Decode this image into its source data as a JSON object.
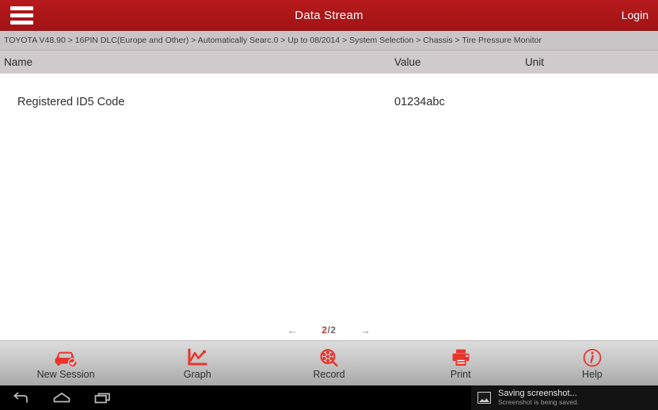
{
  "titlebar": {
    "menu_icon": "hamburger-menu-icon",
    "title": "Data Stream",
    "login_label": "Login",
    "bg_color": "#ab1618"
  },
  "breadcrumb": {
    "text": "TOYOTA V48.90 > 16PIN DLC(Europe and Other) > Automatically Searc.0 > Up to 08/2014 > System Selection > Chassis > Tire Pressure Monitor"
  },
  "table": {
    "headers": {
      "name": "Name",
      "value": "Value",
      "unit": "Unit"
    },
    "rows": [
      {
        "name": "Registered ID5 Code",
        "value": "01234abc",
        "unit": ""
      }
    ]
  },
  "pager": {
    "prev_icon": "arrow-left-icon",
    "next_icon": "arrow-right-icon",
    "current": "2",
    "separator": "/",
    "total": "2",
    "current_color": "#c0392b"
  },
  "toolbar": {
    "items": [
      {
        "label": "New Session",
        "icon": "car-check-icon"
      },
      {
        "label": "Graph",
        "icon": "line-chart-icon"
      },
      {
        "label": "Record",
        "icon": "film-reel-search-icon"
      },
      {
        "label": "Print",
        "icon": "printer-icon"
      },
      {
        "label": "Help",
        "icon": "info-circle-icon"
      }
    ],
    "icon_color": "#e8352c"
  },
  "navbar": {
    "back_icon": "back-arrow-icon",
    "home_icon": "home-icon",
    "recents_icon": "recent-apps-icon"
  },
  "notification": {
    "icon": "image-icon",
    "title": "Saving screenshot...",
    "subtitle": "Screenshot is being saved."
  }
}
